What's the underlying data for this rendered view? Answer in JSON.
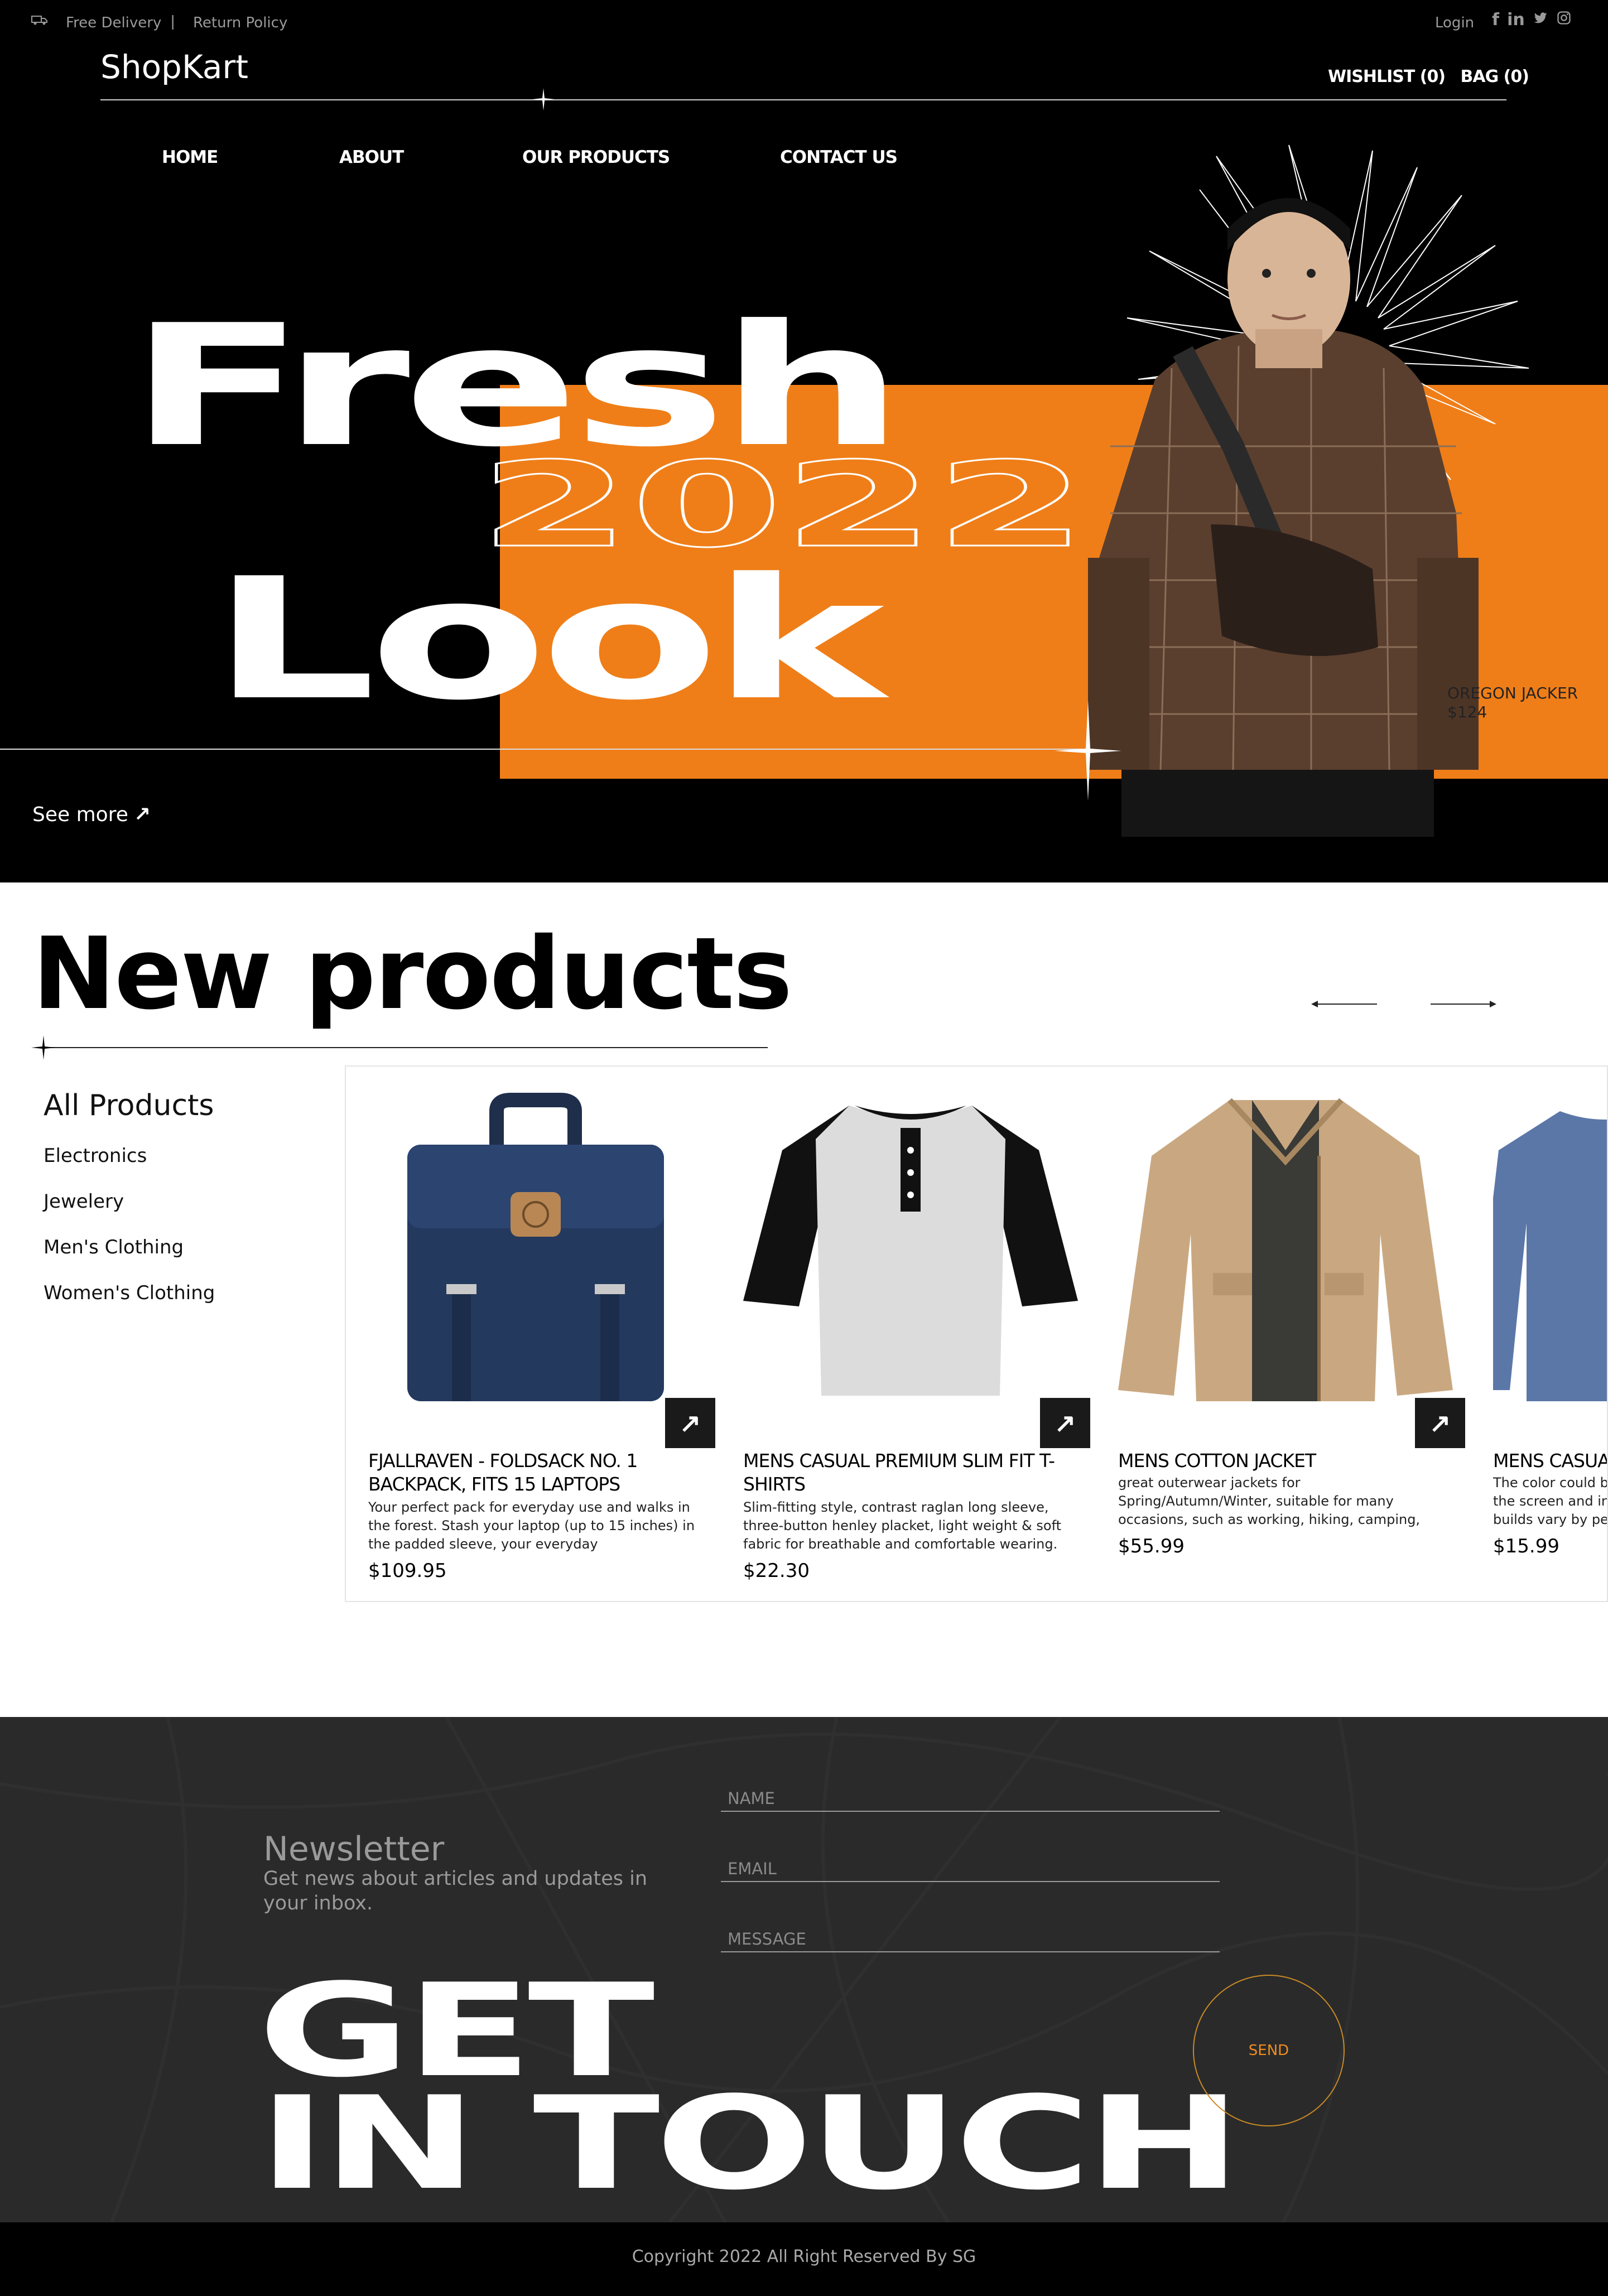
{
  "topbar": {
    "delivery": "Free Delivery",
    "separator": "|",
    "return_policy": "Return Policy",
    "login": "Login",
    "socials": [
      "f",
      "in",
      "t",
      "ig"
    ]
  },
  "header": {
    "logo": "ShopKart",
    "wishlist": "WISHLIST (0)",
    "bag": "BAG (0)"
  },
  "nav": {
    "home": "HOME",
    "about": "ABOUT",
    "products": "OUR PRODUCTS",
    "contact": "CONTACT US"
  },
  "hero": {
    "line1": "Fresh",
    "year": "2022",
    "line2": "Look",
    "product_name": "OREGON JACKER",
    "product_price": "$124",
    "see_more": "See more",
    "accent_color": "#ef7e18"
  },
  "new_products": {
    "title": "New products",
    "categories_title": "All Products",
    "categories": [
      "Electronics",
      "Jewelery",
      "Men's Clothing",
      "Women's Clothing"
    ],
    "items": [
      {
        "title": "FJALLRAVEN - FOLDSACK NO. 1 BACKPACK, FITS 15 LAPTOPS",
        "desc": "Your perfect pack for everyday use and walks in the forest. Stash your laptop (up to 15 inches) in the padded sleeve, your everyday",
        "price": "$109.95",
        "icon": "backpack-image"
      },
      {
        "title": "MENS CASUAL PREMIUM SLIM FIT T-SHIRTS",
        "desc": "Slim-fitting style, contrast raglan long sleeve, three-button henley placket, light weight & soft fabric for breathable and comfortable wearing.",
        "price": "$22.30",
        "icon": "tshirt-image"
      },
      {
        "title": "MENS COTTON JACKET",
        "desc": "great outerwear jackets for Spring/Autumn/Winter, suitable for many occasions, such as working, hiking, camping,",
        "price": "$55.99",
        "icon": "jacket-image"
      },
      {
        "title": "MENS CASUAL SLIM FIT",
        "desc": "The color could be slightly different between on the screen and in practice. Please note that body builds vary by person",
        "price": "$15.99",
        "icon": "longsleeve-image"
      }
    ]
  },
  "contact": {
    "newsletter_title": "Newsletter",
    "newsletter_sub": "Get news about articles and updates in your inbox.",
    "name_placeholder": "NAME",
    "email_placeholder": "EMAIL",
    "message_placeholder": "MESSAGE",
    "get": "GET",
    "in_touch": "IN TOUCH",
    "send": "SEND"
  },
  "footer": {
    "copyright": "Copyright 2022 All Right Reserved By SG"
  }
}
